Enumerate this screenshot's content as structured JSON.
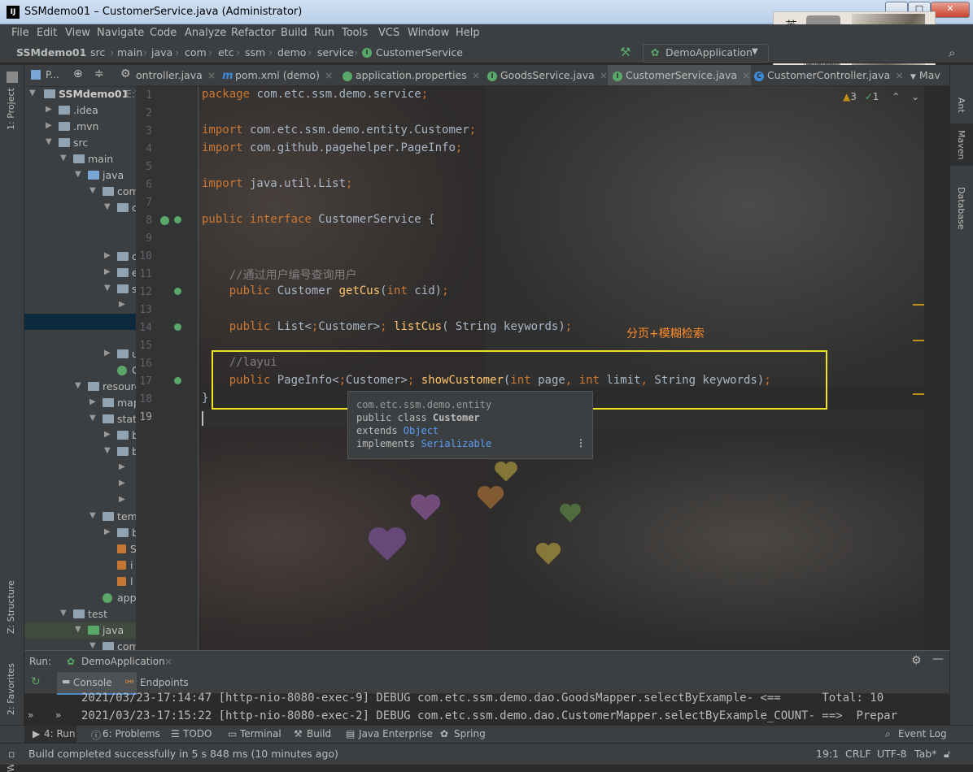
{
  "window": {
    "title": "SSMdemo01 – CustomerService.java (Administrator)",
    "logo_text": "IJ"
  },
  "menu": [
    "File",
    "Edit",
    "View",
    "Navigate",
    "Code",
    "Analyze",
    "Refactor",
    "Build",
    "Run",
    "Tools",
    "VCS",
    "Window",
    "Help"
  ],
  "breadcrumb": [
    "SSMdemo01",
    "src",
    "main",
    "java",
    "com",
    "etc",
    "ssm",
    "demo",
    "service",
    "CustomerService"
  ],
  "run_config": "DemoApplication",
  "left_strip": {
    "project": "1: Project",
    "structure": "Z: Structure",
    "favorites": "2: Favorites",
    "web": "Web"
  },
  "right_strip": {
    "ant": "Ant",
    "maven": "Maven",
    "database": "Database"
  },
  "project_header": "P...",
  "tree": [
    {
      "label": "SSMdemo01",
      "extra": "E:\\"
    },
    {
      "label": ".idea"
    },
    {
      "label": ".mvn"
    },
    {
      "label": "src"
    },
    {
      "label": "main"
    },
    {
      "label": "java"
    },
    {
      "label": "com"
    },
    {
      "label": "c"
    },
    {
      "label": ""
    },
    {
      "label": ""
    },
    {
      "label": "c"
    },
    {
      "label": "e"
    },
    {
      "label": "s"
    },
    {
      "label": ""
    },
    {
      "label": ""
    },
    {
      "label": ""
    },
    {
      "label": "u"
    },
    {
      "label": "C"
    },
    {
      "label": "resources"
    },
    {
      "label": "mapper"
    },
    {
      "label": "static"
    },
    {
      "label": "b"
    },
    {
      "label": "b"
    },
    {
      "label": ""
    },
    {
      "label": ""
    },
    {
      "label": ""
    },
    {
      "label": "templates"
    },
    {
      "label": "b"
    },
    {
      "label": "S"
    },
    {
      "label": "i"
    },
    {
      "label": "l"
    },
    {
      "label": "application"
    },
    {
      "label": "test"
    },
    {
      "label": "java"
    },
    {
      "label": "com"
    }
  ],
  "tabs": [
    {
      "label": "ontroller.java",
      "icon": "C"
    },
    {
      "label": "pom.xml (demo)",
      "icon": "m"
    },
    {
      "label": "application.properties",
      "icon": "leaf"
    },
    {
      "label": "GoodsService.java",
      "icon": "I"
    },
    {
      "label": "CustomerService.java",
      "icon": "I",
      "active": true
    },
    {
      "label": "CustomerController.java",
      "icon": "C"
    }
  ],
  "tab_overflow": "Mav",
  "inspections": {
    "warnings": "3",
    "weak_warnings": "1"
  },
  "code_lines": [
    {
      "n": "1",
      "text": "package com.etc.ssm.demo.service;"
    },
    {
      "n": "2",
      "text": ""
    },
    {
      "n": "3",
      "text": "import com.etc.ssm.demo.entity.Customer;"
    },
    {
      "n": "4",
      "text": "import com.github.pagehelper.PageInfo;"
    },
    {
      "n": "5",
      "text": ""
    },
    {
      "n": "6",
      "text": "import java.util.List;"
    },
    {
      "n": "7",
      "text": ""
    },
    {
      "n": "8",
      "text": "public interface CustomerService {"
    },
    {
      "n": "9",
      "text": ""
    },
    {
      "n": "10",
      "text": ""
    },
    {
      "n": "11",
      "text": "    //通过用户编号查询用户"
    },
    {
      "n": "12",
      "text": "    public Customer getCus(int cid);"
    },
    {
      "n": "13",
      "text": ""
    },
    {
      "n": "14",
      "text": "    public List<Customer> listCus( String keywords);"
    },
    {
      "n": "15",
      "text": ""
    },
    {
      "n": "16",
      "text": "    //layui"
    },
    {
      "n": "17",
      "text": "    public PageInfo<Customer> showCustomer(int page, int limit, String keywords);"
    },
    {
      "n": "18",
      "text": "}"
    },
    {
      "n": "19",
      "text": ""
    }
  ],
  "annotation": "分页+模糊检索",
  "popup": {
    "line1": "com.etc.ssm.demo.entity",
    "line2a": "public class ",
    "line2b": "Customer",
    "line3a": "extends ",
    "line3b": "Object",
    "line4a": "implements ",
    "line4b": "Serializable"
  },
  "run_panel": {
    "label": "Run:",
    "config": "DemoApplication",
    "tab_console": "Console",
    "tab_endpoints": "Endpoints",
    "log1": "2021/03/23-17:14:47 [http-nio-8080-exec-9] DEBUG com.etc.ssm.demo.dao.GoodsMapper.selectByExample- <==      Total: 10",
    "log2": "2021/03/23-17:15:22 [http-nio-8080-exec-2] DEBUG com.etc.ssm.demo.dao.CustomerMapper.selectByExample_COUNT- ==>  Prepar"
  },
  "toolwindows": [
    "4: Run",
    "6: Problems",
    "TODO",
    "Terminal",
    "Build",
    "Java Enterprise",
    "Spring"
  ],
  "event_log": "Event Log",
  "status": {
    "message": "Build completed successfully in 5 s 848 ms (10 minutes ago)",
    "position": "19:1",
    "line_sep": "CRLF",
    "encoding": "UTF-8",
    "indent": "Tab*"
  },
  "sticker": {
    "left": "英简",
    "right": "THE UNTAMED"
  },
  "colors": {
    "accent": "#4a88c7",
    "highlight_box": "#f2e21f",
    "annotation": "#ff8c2a",
    "keyword": "#cc7832",
    "method": "#ffc66d"
  }
}
